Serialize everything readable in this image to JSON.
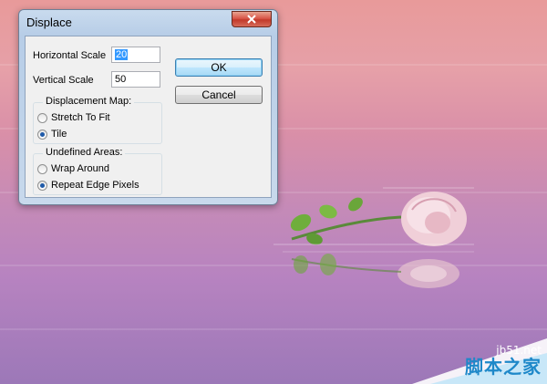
{
  "dialog": {
    "title": "Displace",
    "close_icon": "close-icon",
    "horizontal_scale": {
      "label": "Horizontal Scale",
      "value": "20"
    },
    "vertical_scale": {
      "label": "Vertical Scale",
      "value": "50"
    },
    "ok_label": "OK",
    "cancel_label": "Cancel",
    "displacement_map": {
      "legend": "Displacement Map:",
      "options": [
        {
          "label": "Stretch To Fit",
          "checked": false
        },
        {
          "label": "Tile",
          "checked": true
        }
      ]
    },
    "undefined_areas": {
      "legend": "Undefined Areas:",
      "options": [
        {
          "label": "Wrap Around",
          "checked": false
        },
        {
          "label": "Repeat Edge Pixels",
          "checked": true
        }
      ]
    }
  },
  "watermark": {
    "url": "jb51.net",
    "name": "脚本之家"
  },
  "colors": {
    "accent": "#3399ff",
    "title_bar": "#b7cde7",
    "close_button": "#c23a2b",
    "watermark_blue": "#1e88c9"
  }
}
